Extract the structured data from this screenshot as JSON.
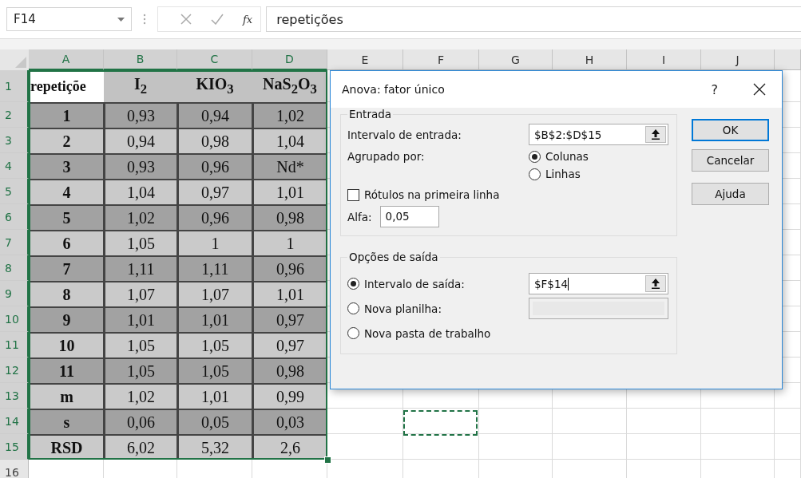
{
  "formula_bar": {
    "name_box": "F14",
    "function_label": "fx",
    "formula": "repetições"
  },
  "columns": [
    {
      "label": "A",
      "selected": true
    },
    {
      "label": "B",
      "selected": true
    },
    {
      "label": "C",
      "selected": true
    },
    {
      "label": "D",
      "selected": true
    },
    {
      "label": "E",
      "selected": false
    },
    {
      "label": "F",
      "selected": false
    },
    {
      "label": "G",
      "selected": false
    },
    {
      "label": "H",
      "selected": false
    },
    {
      "label": "I",
      "selected": false
    },
    {
      "label": "J",
      "selected": false
    }
  ],
  "rows": [
    {
      "header": "1",
      "selected": true,
      "kind": "heading",
      "cells": [
        "repetiçõe",
        "I$_{2}$",
        "KIO$_{3}$",
        "NaS$_{2}$O$_{3}$"
      ]
    },
    {
      "header": "2",
      "selected": true,
      "kind": "dark",
      "cells": [
        "1",
        "0,93",
        "0,94",
        "1,02"
      ]
    },
    {
      "header": "3",
      "selected": true,
      "kind": "light",
      "cells": [
        "2",
        "0,94",
        "0,98",
        "1,04"
      ]
    },
    {
      "header": "4",
      "selected": true,
      "kind": "dark",
      "cells": [
        "3",
        "0,93",
        "0,96",
        "Nd*"
      ]
    },
    {
      "header": "5",
      "selected": true,
      "kind": "light",
      "cells": [
        "4",
        "1,04",
        "0,97",
        "1,01"
      ]
    },
    {
      "header": "6",
      "selected": true,
      "kind": "dark",
      "cells": [
        "5",
        "1,02",
        "0,96",
        "0,98"
      ]
    },
    {
      "header": "7",
      "selected": true,
      "kind": "light",
      "cells": [
        "6",
        "1,05",
        "1",
        "1"
      ]
    },
    {
      "header": "8",
      "selected": true,
      "kind": "dark",
      "cells": [
        "7",
        "1,11",
        "1,11",
        "0,96"
      ]
    },
    {
      "header": "9",
      "selected": true,
      "kind": "light",
      "cells": [
        "8",
        "1,07",
        "1,07",
        "1,01"
      ]
    },
    {
      "header": "10",
      "selected": true,
      "kind": "dark",
      "cells": [
        "9",
        "1,01",
        "1,01",
        "0,97"
      ]
    },
    {
      "header": "11",
      "selected": true,
      "kind": "light",
      "cells": [
        "10",
        "1,05",
        "1,05",
        "0,97"
      ]
    },
    {
      "header": "12",
      "selected": true,
      "kind": "dark",
      "cells": [
        "11",
        "1,05",
        "1,05",
        "0,98"
      ]
    },
    {
      "header": "13",
      "selected": true,
      "kind": "light",
      "cells": [
        "m",
        "1,02",
        "1,01",
        "0,99"
      ]
    },
    {
      "header": "14",
      "selected": true,
      "kind": "dark",
      "cells": [
        "s",
        "0,06",
        "0,05",
        "0,03"
      ]
    },
    {
      "header": "15",
      "selected": true,
      "kind": "light",
      "cells": [
        "RSD",
        "6,02",
        "5,32",
        "2,6"
      ]
    },
    {
      "header": "16",
      "selected": false,
      "kind": "empty"
    }
  ],
  "dialog": {
    "title": "Anova: fator único",
    "help": "?",
    "input_group": {
      "legend": "Entrada",
      "range_label": "Intervalo de entrada:",
      "range_value": "$B$2:$D$15",
      "grouped_label": "Agrupado por:",
      "grouped_options": [
        {
          "label": "Colunas",
          "selected": true
        },
        {
          "label": "Linhas",
          "selected": false
        }
      ],
      "labels_checkbox": {
        "label": "Rótulos na primeira linha",
        "checked": false
      },
      "alpha_label": "Alfa:",
      "alpha_value": "0,05"
    },
    "output_group": {
      "legend": "Opções de saída",
      "options": [
        {
          "label": "Intervalo de saída:",
          "selected": true,
          "kind": "range",
          "value": "$F$14"
        },
        {
          "label": "Nova planilha:",
          "selected": false,
          "kind": "sheet"
        },
        {
          "label": "Nova pasta de trabalho",
          "selected": false,
          "kind": "workbook"
        }
      ]
    },
    "buttons": [
      {
        "label": "OK",
        "default": true
      },
      {
        "label": "Cancelar",
        "default": false
      },
      {
        "label": "Ajuda",
        "default": false
      }
    ]
  }
}
